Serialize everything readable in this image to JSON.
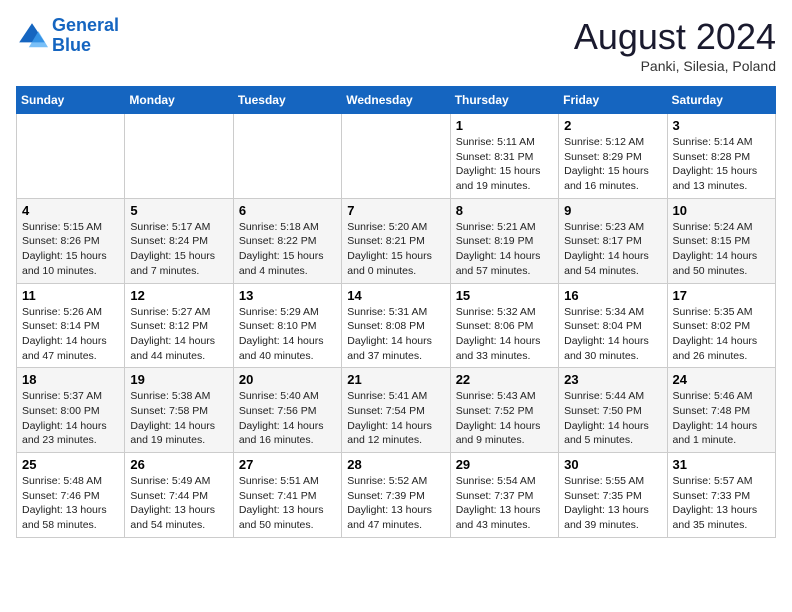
{
  "header": {
    "logo_line1": "General",
    "logo_line2": "Blue",
    "month_title": "August 2024",
    "location": "Panki, Silesia, Poland"
  },
  "weekdays": [
    "Sunday",
    "Monday",
    "Tuesday",
    "Wednesday",
    "Thursday",
    "Friday",
    "Saturday"
  ],
  "weeks": [
    [
      {
        "day": "",
        "info": ""
      },
      {
        "day": "",
        "info": ""
      },
      {
        "day": "",
        "info": ""
      },
      {
        "day": "",
        "info": ""
      },
      {
        "day": "1",
        "info": "Sunrise: 5:11 AM\nSunset: 8:31 PM\nDaylight: 15 hours\nand 19 minutes."
      },
      {
        "day": "2",
        "info": "Sunrise: 5:12 AM\nSunset: 8:29 PM\nDaylight: 15 hours\nand 16 minutes."
      },
      {
        "day": "3",
        "info": "Sunrise: 5:14 AM\nSunset: 8:28 PM\nDaylight: 15 hours\nand 13 minutes."
      }
    ],
    [
      {
        "day": "4",
        "info": "Sunrise: 5:15 AM\nSunset: 8:26 PM\nDaylight: 15 hours\nand 10 minutes."
      },
      {
        "day": "5",
        "info": "Sunrise: 5:17 AM\nSunset: 8:24 PM\nDaylight: 15 hours\nand 7 minutes."
      },
      {
        "day": "6",
        "info": "Sunrise: 5:18 AM\nSunset: 8:22 PM\nDaylight: 15 hours\nand 4 minutes."
      },
      {
        "day": "7",
        "info": "Sunrise: 5:20 AM\nSunset: 8:21 PM\nDaylight: 15 hours\nand 0 minutes."
      },
      {
        "day": "8",
        "info": "Sunrise: 5:21 AM\nSunset: 8:19 PM\nDaylight: 14 hours\nand 57 minutes."
      },
      {
        "day": "9",
        "info": "Sunrise: 5:23 AM\nSunset: 8:17 PM\nDaylight: 14 hours\nand 54 minutes."
      },
      {
        "day": "10",
        "info": "Sunrise: 5:24 AM\nSunset: 8:15 PM\nDaylight: 14 hours\nand 50 minutes."
      }
    ],
    [
      {
        "day": "11",
        "info": "Sunrise: 5:26 AM\nSunset: 8:14 PM\nDaylight: 14 hours\nand 47 minutes."
      },
      {
        "day": "12",
        "info": "Sunrise: 5:27 AM\nSunset: 8:12 PM\nDaylight: 14 hours\nand 44 minutes."
      },
      {
        "day": "13",
        "info": "Sunrise: 5:29 AM\nSunset: 8:10 PM\nDaylight: 14 hours\nand 40 minutes."
      },
      {
        "day": "14",
        "info": "Sunrise: 5:31 AM\nSunset: 8:08 PM\nDaylight: 14 hours\nand 37 minutes."
      },
      {
        "day": "15",
        "info": "Sunrise: 5:32 AM\nSunset: 8:06 PM\nDaylight: 14 hours\nand 33 minutes."
      },
      {
        "day": "16",
        "info": "Sunrise: 5:34 AM\nSunset: 8:04 PM\nDaylight: 14 hours\nand 30 minutes."
      },
      {
        "day": "17",
        "info": "Sunrise: 5:35 AM\nSunset: 8:02 PM\nDaylight: 14 hours\nand 26 minutes."
      }
    ],
    [
      {
        "day": "18",
        "info": "Sunrise: 5:37 AM\nSunset: 8:00 PM\nDaylight: 14 hours\nand 23 minutes."
      },
      {
        "day": "19",
        "info": "Sunrise: 5:38 AM\nSunset: 7:58 PM\nDaylight: 14 hours\nand 19 minutes."
      },
      {
        "day": "20",
        "info": "Sunrise: 5:40 AM\nSunset: 7:56 PM\nDaylight: 14 hours\nand 16 minutes."
      },
      {
        "day": "21",
        "info": "Sunrise: 5:41 AM\nSunset: 7:54 PM\nDaylight: 14 hours\nand 12 minutes."
      },
      {
        "day": "22",
        "info": "Sunrise: 5:43 AM\nSunset: 7:52 PM\nDaylight: 14 hours\nand 9 minutes."
      },
      {
        "day": "23",
        "info": "Sunrise: 5:44 AM\nSunset: 7:50 PM\nDaylight: 14 hours\nand 5 minutes."
      },
      {
        "day": "24",
        "info": "Sunrise: 5:46 AM\nSunset: 7:48 PM\nDaylight: 14 hours\nand 1 minute."
      }
    ],
    [
      {
        "day": "25",
        "info": "Sunrise: 5:48 AM\nSunset: 7:46 PM\nDaylight: 13 hours\nand 58 minutes."
      },
      {
        "day": "26",
        "info": "Sunrise: 5:49 AM\nSunset: 7:44 PM\nDaylight: 13 hours\nand 54 minutes."
      },
      {
        "day": "27",
        "info": "Sunrise: 5:51 AM\nSunset: 7:41 PM\nDaylight: 13 hours\nand 50 minutes."
      },
      {
        "day": "28",
        "info": "Sunrise: 5:52 AM\nSunset: 7:39 PM\nDaylight: 13 hours\nand 47 minutes."
      },
      {
        "day": "29",
        "info": "Sunrise: 5:54 AM\nSunset: 7:37 PM\nDaylight: 13 hours\nand 43 minutes."
      },
      {
        "day": "30",
        "info": "Sunrise: 5:55 AM\nSunset: 7:35 PM\nDaylight: 13 hours\nand 39 minutes."
      },
      {
        "day": "31",
        "info": "Sunrise: 5:57 AM\nSunset: 7:33 PM\nDaylight: 13 hours\nand 35 minutes."
      }
    ]
  ]
}
